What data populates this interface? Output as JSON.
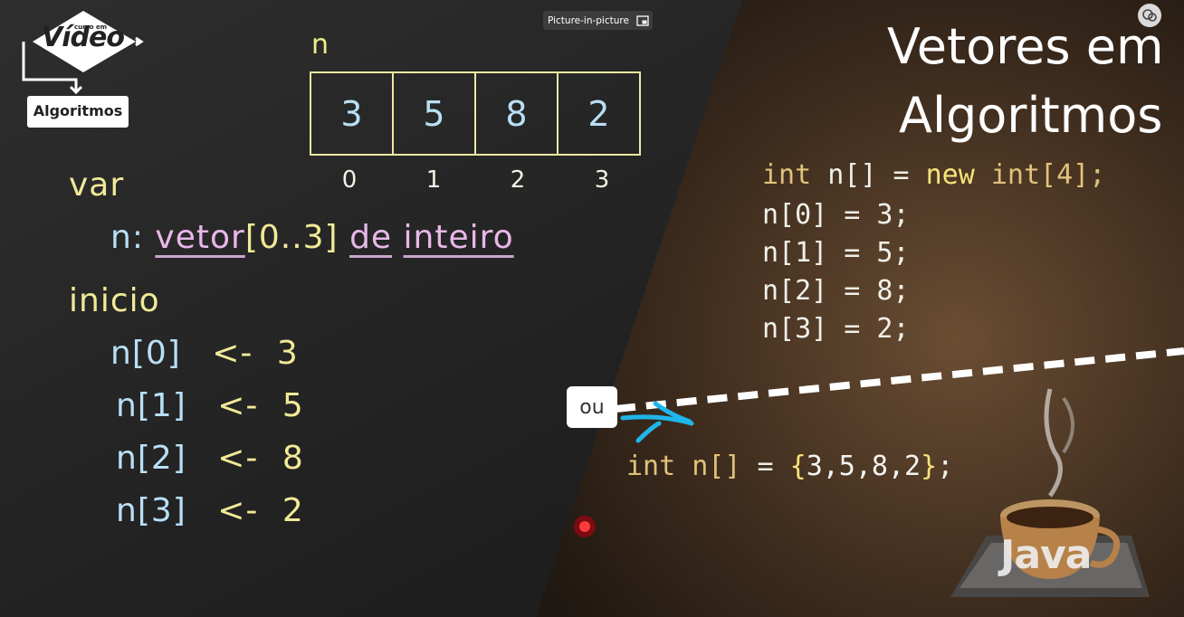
{
  "overlay": {
    "pip_label": "Picture-in-picture",
    "pip_icon": "picture-in-picture-icon",
    "corner_icon": "media-settings-icon"
  },
  "logo": {
    "top_text": "curso em",
    "brand": "Vídeo",
    "label": "Algoritmos"
  },
  "diagram": {
    "name": "n",
    "values": [
      "3",
      "5",
      "8",
      "2"
    ],
    "indices": [
      "0",
      "1",
      "2",
      "3"
    ]
  },
  "pseudocode": {
    "var_kw": "var",
    "decl_name": "n:",
    "decl_type": "vetor",
    "decl_range": "[0..3]",
    "decl_de": "de",
    "decl_inteiro": "inteiro",
    "inicio_kw": "inicio",
    "assignments": [
      {
        "lhs": "n[0]",
        "op": "<-",
        "rhs": "3"
      },
      {
        "lhs": "n[1]",
        "op": "<-",
        "rhs": "5"
      },
      {
        "lhs": "n[2]",
        "op": "<-",
        "rhs": "8"
      },
      {
        "lhs": "n[3]",
        "op": "<-",
        "rhs": "2"
      }
    ]
  },
  "java": {
    "title_line1": "Vetores em",
    "title_line2": "Algoritmos",
    "decl": {
      "kw": "int",
      "rest": "n[]",
      "eq": "=",
      "new": "new",
      "type": "int[4];"
    },
    "lines": [
      "n[0] = 3;",
      "n[1] = 5;",
      "n[2] = 8;",
      "n[3] = 2;"
    ],
    "or_label": "ou",
    "inline": {
      "kw": "int",
      "name": "n[]",
      "eq": "=",
      "open": "{",
      "vals": "3,5,8,2",
      "close": "}",
      "end": ";"
    },
    "brand": "Java"
  },
  "colors": {
    "chalk_yellow": "#f1ea98",
    "chalk_blue": "#b9dff6",
    "chalk_pink": "#e8b8e9",
    "annotation_blue": "#1fb6ea",
    "pointer_red": "#e0141e"
  }
}
